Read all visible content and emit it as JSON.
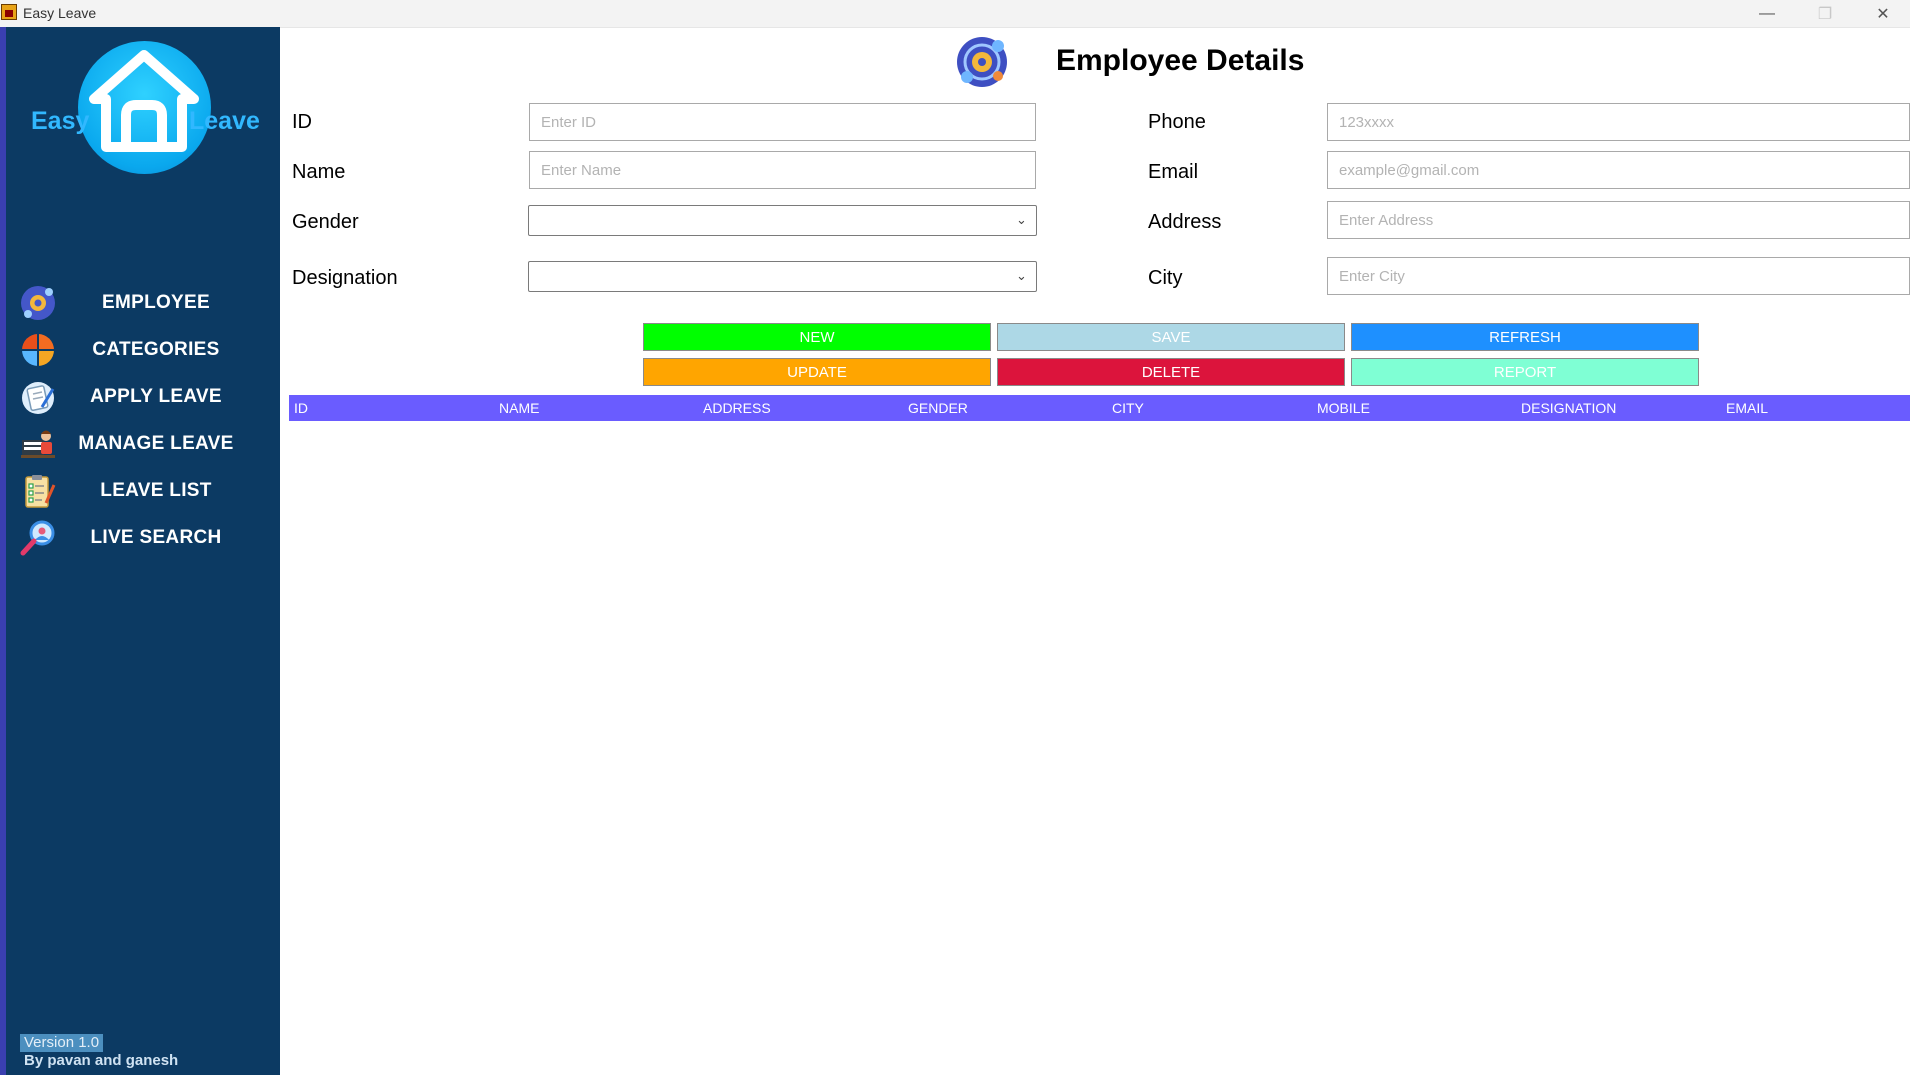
{
  "window": {
    "title": "Easy Leave",
    "controls": [
      "minimize",
      "maximize",
      "close"
    ]
  },
  "sidebar": {
    "logo": {
      "left_text": "Easy",
      "right_text": "Leave"
    },
    "items": [
      {
        "label": "EMPLOYEE",
        "icon": "employee-gear-icon"
      },
      {
        "label": "CATEGORIES",
        "icon": "categories-icon"
      },
      {
        "label": "APPLY LEAVE",
        "icon": "apply-leave-icon"
      },
      {
        "label": "MANAGE LEAVE",
        "icon": "manage-leave-icon"
      },
      {
        "label": "LEAVE LIST",
        "icon": "checklist-icon"
      },
      {
        "label": "LIVE SEARCH",
        "icon": "search-user-icon"
      }
    ],
    "version": "Version 1.0",
    "credits": "By pavan and ganesh"
  },
  "main": {
    "title": "Employee Details",
    "form": {
      "id": {
        "label": "ID",
        "placeholder": "Enter ID",
        "value": ""
      },
      "name": {
        "label": "Name",
        "placeholder": "Enter Name",
        "value": ""
      },
      "gender": {
        "label": "Gender",
        "value": ""
      },
      "designation": {
        "label": "Designation",
        "value": ""
      },
      "phone": {
        "label": "Phone",
        "placeholder": "123xxxx",
        "value": ""
      },
      "email": {
        "label": "Email",
        "placeholder": "example@gmail.com",
        "value": ""
      },
      "address": {
        "label": "Address",
        "placeholder": "Enter Address",
        "value": ""
      },
      "city": {
        "label": "City",
        "placeholder": "Enter City",
        "value": ""
      }
    },
    "buttons": {
      "new": "NEW",
      "save": "SAVE",
      "refresh": "REFRESH",
      "update": "UPDATE",
      "delete": "DELETE",
      "report": "REPORT"
    },
    "button_colors": {
      "new": "#00ff00",
      "save": "#add8e6",
      "refresh": "#1e90ff",
      "update": "#ffa500",
      "delete": "#dc143c",
      "report": "#7fffd4"
    },
    "table": {
      "columns": [
        "ID",
        "NAME",
        "ADDRESS",
        "GENDER",
        "CITY",
        "MOBILE",
        "DESIGNATION",
        "EMAIL"
      ],
      "header_color": "#6a5cff",
      "rows": []
    }
  },
  "colors": {
    "sidebar_bg": "#0c3a63",
    "logo_accent": "#0aa8ee"
  }
}
